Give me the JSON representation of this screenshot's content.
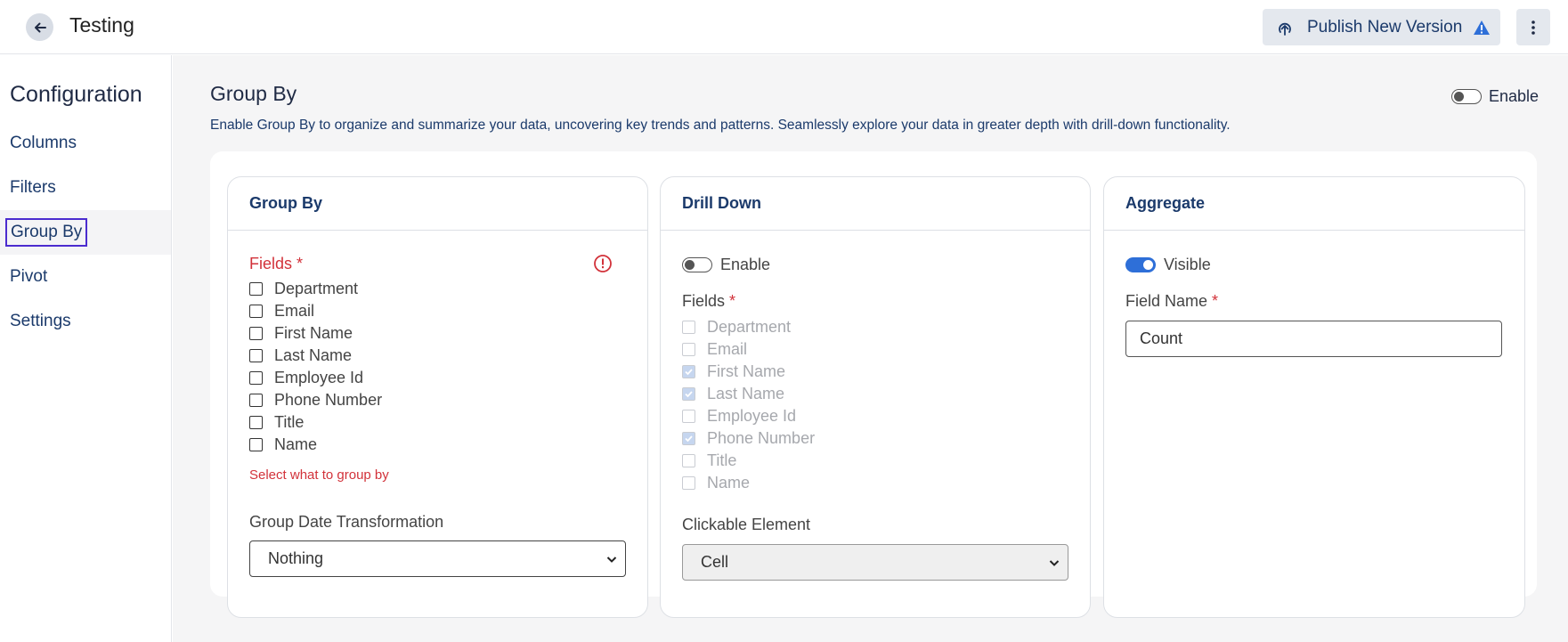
{
  "header": {
    "title": "Testing",
    "publish_label": "Publish New Version"
  },
  "sidebar": {
    "title": "Configuration",
    "items": [
      {
        "label": "Columns"
      },
      {
        "label": "Filters"
      },
      {
        "label": "Group By"
      },
      {
        "label": "Pivot"
      },
      {
        "label": "Settings"
      }
    ],
    "active": "Group By"
  },
  "main": {
    "title": "Group By",
    "description": "Enable Group By to organize and summarize your data, uncovering key trends and patterns. Seamlessly explore your data in greater depth with drill-down functionality.",
    "enable_label": "Enable",
    "enable_on": false
  },
  "group_by_panel": {
    "title": "Group By",
    "fields_label": "Fields",
    "required_mark": "*",
    "fields": [
      "Department",
      "Email",
      "First Name",
      "Last Name",
      "Employee Id",
      "Phone Number",
      "Title",
      "Name"
    ],
    "error_text": "Select what to group by",
    "date_transform_label": "Group Date Transformation",
    "date_transform_value": "Nothing"
  },
  "drill_down_panel": {
    "title": "Drill Down",
    "enable_label": "Enable",
    "enable_on": false,
    "fields_label": "Fields",
    "required_mark": "*",
    "fields": [
      {
        "label": "Department",
        "checked": false
      },
      {
        "label": "Email",
        "checked": false
      },
      {
        "label": "First Name",
        "checked": true
      },
      {
        "label": "Last Name",
        "checked": true
      },
      {
        "label": "Employee Id",
        "checked": false
      },
      {
        "label": "Phone Number",
        "checked": true
      },
      {
        "label": "Title",
        "checked": false
      },
      {
        "label": "Name",
        "checked": false
      }
    ],
    "clickable_label": "Clickable Element",
    "clickable_value": "Cell"
  },
  "aggregate_panel": {
    "title": "Aggregate",
    "visible_label": "Visible",
    "visible_on": true,
    "field_name_label": "Field Name",
    "required_mark": "*",
    "field_name_value": "Count"
  },
  "colors": {
    "accent": "#2e6fd8",
    "error": "#d2323a",
    "active_outline": "#4b2ccf",
    "warning": "#2e6fd8"
  }
}
